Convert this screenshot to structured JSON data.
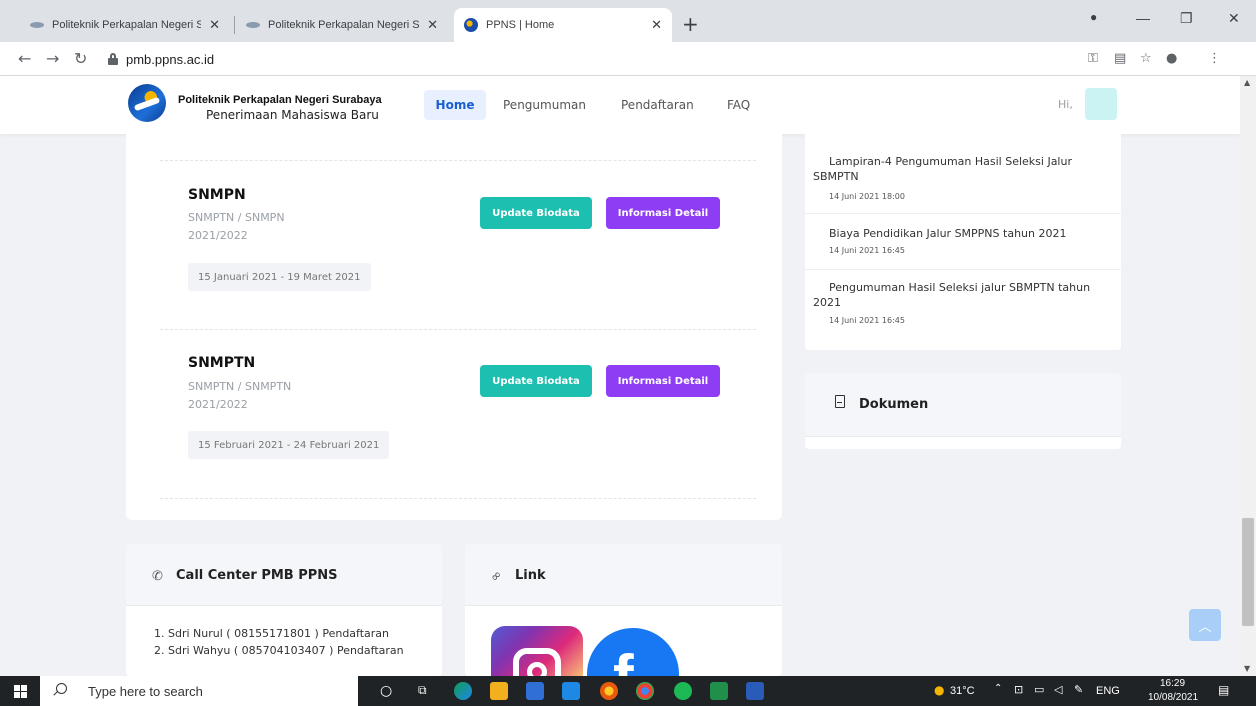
{
  "browser": {
    "tabs": [
      {
        "title": "Politeknik Perkapalan Negeri Sura",
        "active": false
      },
      {
        "title": "Politeknik Perkapalan Negeri Sura",
        "active": false
      },
      {
        "title": "PPNS | Home",
        "active": true
      }
    ],
    "url": "pmb.ppns.ac.id"
  },
  "header": {
    "brand_line1": "Politeknik Perkapalan Negeri Surabaya",
    "brand_line2": "Penerimaan Mahasiswa Baru",
    "nav": [
      "Home",
      "Pengumuman",
      "Pendaftaran",
      "FAQ"
    ],
    "active_nav": "Home",
    "greeting": "Hi,"
  },
  "programs": [
    {
      "name": "SNMPN",
      "path": "SNMPTN / SNMPN",
      "year": "2021/2022",
      "period": "15 Januari 2021 - 19 Maret 2021",
      "btn_update": "Update Biodata",
      "btn_detail": "Informasi Detail"
    },
    {
      "name": "SNMPTN",
      "path": "SNMPTN / SNMPTN",
      "year": "2021/2022",
      "period": "15 Februari 2021 - 24 Februari 2021",
      "btn_update": "Update Biodata",
      "btn_detail": "Informasi Detail"
    }
  ],
  "announcements": [
    {
      "title": "Lampiran-4 Pengumuman Hasil Seleksi Jalur SBMPTN",
      "time": "14 Juni 2021 18:00"
    },
    {
      "title": "Biaya Pendidikan Jalur SMPPNS tahun 2021",
      "time": "14 Juni 2021 16:45"
    },
    {
      "title": "Pengumuman Hasil Seleksi jalur SBMPTN tahun 2021",
      "time": "14 Juni 2021 16:45"
    }
  ],
  "documents": {
    "title": "Dokumen"
  },
  "call_center": {
    "title": "Call Center PMB PPNS",
    "lines": [
      "1. Sdri Nurul ( 08155171801 ) Pendaftaran",
      "2. Sdri Wahyu ( 085704103407 ) Pendaftaran"
    ]
  },
  "links": {
    "title": "Link"
  },
  "taskbar": {
    "search_placeholder": "Type here to search",
    "weather": "31°C",
    "lang": "ENG",
    "time": "16:29",
    "date": "10/08/2021"
  },
  "colors": {
    "btn_update": "#1dbfb0",
    "btn_detail": "#8f3cf5",
    "nav_active": "#1a5fd0",
    "back_to_top": "#a9cef7"
  }
}
